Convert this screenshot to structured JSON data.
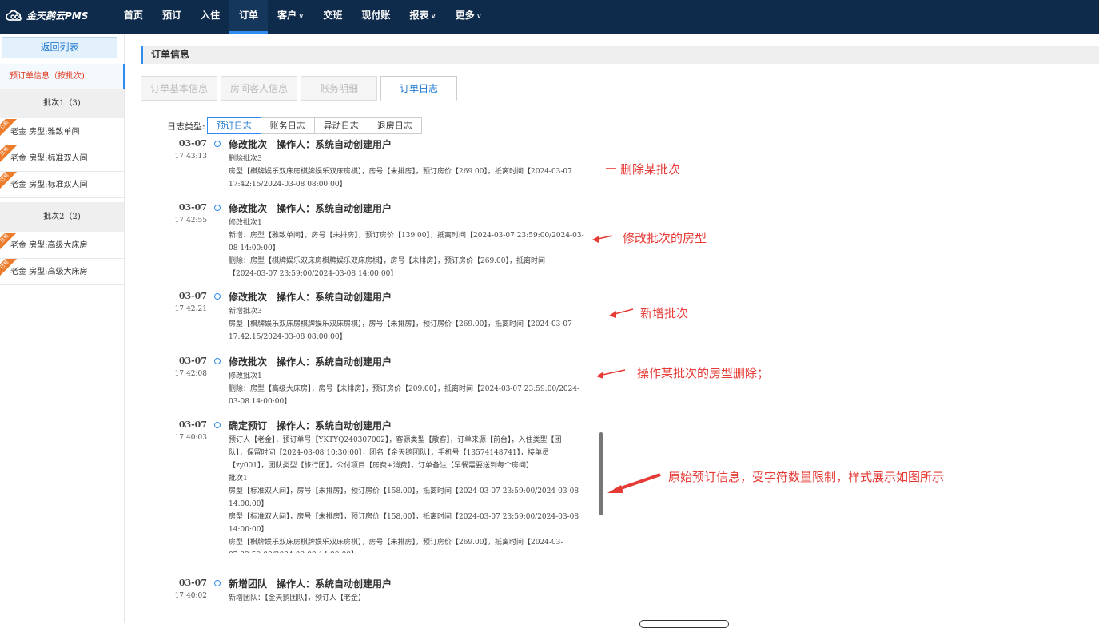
{
  "app": {
    "logo_text": "金天鹅云PMS"
  },
  "nav": {
    "items": [
      {
        "label": "首页",
        "caret": ""
      },
      {
        "label": "预订",
        "caret": ""
      },
      {
        "label": "入住",
        "caret": ""
      },
      {
        "label": "订单",
        "caret": ""
      },
      {
        "label": "客户",
        "caret": "∨"
      },
      {
        "label": "交班",
        "caret": ""
      },
      {
        "label": "现付账",
        "caret": ""
      },
      {
        "label": "报表",
        "caret": "∨"
      },
      {
        "label": "更多",
        "caret": "∨"
      }
    ],
    "active_index": 3
  },
  "sidebar": {
    "back_label": "返回列表",
    "booking_info": "预订单信息（按批次)",
    "ribbon_text": "已预",
    "batches": [
      {
        "title": "批次1（3)",
        "rooms": [
          "老金 房型:雅致单间",
          "老金 房型:标准双人间",
          "老金 房型:标准双人间"
        ]
      },
      {
        "title": "批次2（2)",
        "rooms": [
          "老金 房型:高级大床房",
          "老金 房型:高级大床房"
        ]
      }
    ]
  },
  "main": {
    "section_title": "订单信息",
    "tabs": [
      "订单基本信息",
      "房间客人信息",
      "账务明细",
      "订单日志"
    ],
    "active_tab": 3,
    "log_type_label": "日志类型:",
    "log_types": [
      "预订日志",
      "账务日志",
      "异动日志",
      "退房日志"
    ],
    "active_log_type": 0,
    "entries": [
      {
        "date": "03-07",
        "time": "17:43:13",
        "action": "修改批次",
        "operator": "操作人：系统自动创建用户",
        "lines": [
          "删除批次3",
          "房型【棋牌娱乐双床房棋牌娱乐双床房棋】，房号【未排房】，预订房价【269.00】，抵离时间【2024-03-07",
          "17:42:15/2024-03-08 08:00:00】"
        ]
      },
      {
        "date": "03-07",
        "time": "17:42:55",
        "action": "修改批次",
        "operator": "操作人：系统自动创建用户",
        "lines": [
          "修改批次1",
          "新增：房型【雅致单间】，房号【未排房】，预订房价【139.00】，抵离时间【2024-03-07 23:59:00/2024-03-",
          "08 14:00:00】",
          "删除：房型【棋牌娱乐双床房棋牌娱乐双床房棋】，房号【未排房】，预订房价【269.00】，抵离时间",
          "【2024-03-07 23:59:00/2024-03-08 14:00:00】"
        ]
      },
      {
        "date": "03-07",
        "time": "17:42:21",
        "action": "修改批次",
        "operator": "操作人：系统自动创建用户",
        "lines": [
          "新增批次3",
          "房型【棋牌娱乐双床房棋牌娱乐双床房棋】，房号【未排房】，预订房价【269.00】，抵离时间【2024-03-07",
          "17:42:15/2024-03-08 08:00:00】"
        ]
      },
      {
        "date": "03-07",
        "time": "17:42:08",
        "action": "修改批次",
        "operator": "操作人：系统自动创建用户",
        "lines": [
          "修改批次1",
          "删除：房型【高级大床房】，房号【未排房】，预订房价【209.00】，抵离时间【2024-03-07 23:59:00/2024-",
          "03-08 14:00:00】"
        ]
      },
      {
        "date": "03-07",
        "time": "17:40:03",
        "action": "确定预订",
        "operator": "操作人：系统自动创建用户",
        "lines": [
          "预订人【老金】，预订单号【YKTYQ240307002】，客源类型【散客】，订单来源【前台】，入住类型【团",
          "队】，保留时间【2024-03-08 10:30:00】，团名【金天鹅团队】，手机号【13574148741】，接单员",
          "【zy001】，团队类型【旅行团】，公付项目【房费+消费】，订单备注【早餐需要送到每个房间】",
          "批次1",
          "房型【标准双人间】，房号【未排房】，预订房价【158.00】，抵离时间【2024-03-07 23:59:00/2024-03-08",
          "14:00:00】",
          "房型【标准双人间】，房号【未排房】，预订房价【158.00】，抵离时间【2024-03-07 23:59:00/2024-03-08",
          "14:00:00】",
          "房型【棋牌娱乐双床房棋牌娱乐双床房棋】，房号【未排房】，预订房价【269.00】，抵离时间【2024-03-",
          "07 23:59:00/2024-03-08 14:00:00】",
          "房型【高级大床房】，房号【未排房】，预订房价【209.00】，抵离时间【2024-03-07 23:59:00/2024-03-08"
        ]
      },
      {
        "date": "03-07",
        "time": "17:40:02",
        "action": "新增团队",
        "operator": "操作人：系统自动创建用户",
        "lines": [
          "新增团队：【金天鹅团队】，预订人【老金】"
        ]
      }
    ]
  },
  "annotations": [
    "删除某批次",
    "修改批次的房型",
    "新增批次",
    "操作某批次的房型删除；",
    "原始预订信息，受字符数量限制，样式展示如图所示"
  ],
  "colors": {
    "topbar": "#0f2b4b",
    "accent": "#2f8bf0",
    "annotation": "#e53a35",
    "ribbon": "#ec7c2b"
  }
}
